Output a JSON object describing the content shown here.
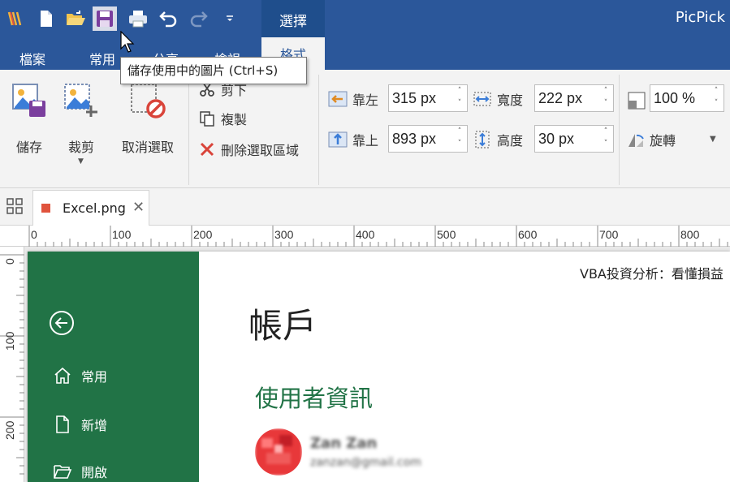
{
  "app": {
    "title": "PicPick"
  },
  "menu": {
    "items": [
      "檔案",
      "常用",
      "分享",
      "檢視"
    ],
    "context_tab": "選擇",
    "active_tab": "格式"
  },
  "tooltip": {
    "text": "儲存使用中的圖片 (Ctrl+S)"
  },
  "ribbon": {
    "save_label": "儲存",
    "crop_label": "裁剪",
    "deselect_label": "取消選取",
    "cut_label": "剪下",
    "copy_label": "複製",
    "delete_label": "刪除選取區域",
    "left_label": "靠左",
    "top_label": "靠上",
    "width_label": "寬度",
    "height_label": "高度",
    "left_value": "315 px",
    "top_value": "893 px",
    "width_value": "222 px",
    "height_value": "30 px",
    "zoom_value": "100 %",
    "rotate_label": "旋轉"
  },
  "tabs": {
    "document_name": "Excel.png"
  },
  "ruler": {
    "top_ticks": [
      "0",
      "100",
      "200",
      "300",
      "400",
      "500",
      "600",
      "700",
      "800"
    ],
    "left_ticks": [
      "0",
      "100",
      "200"
    ]
  },
  "excel": {
    "window_title": "VBA投資分析：看懂損益",
    "page_heading": "帳戶",
    "section_heading": "使用者資訊",
    "nav_items": [
      "常用",
      "新增",
      "開啟"
    ],
    "user_name": "Zan Zan",
    "user_email": "zanzan@gmail.com"
  },
  "colors": {
    "titlebar": "#2b579a",
    "excel_green": "#217346",
    "accent_red": "#e0533d"
  }
}
